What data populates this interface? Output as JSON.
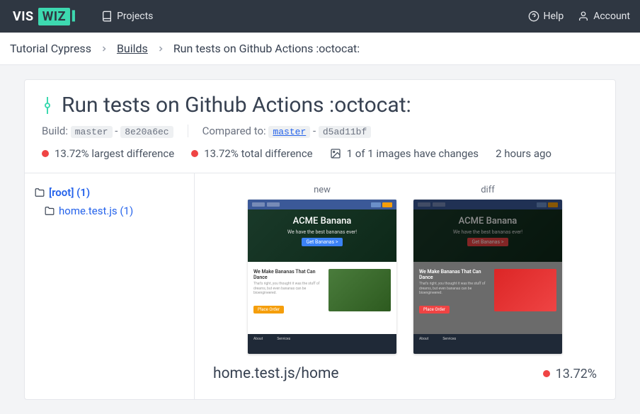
{
  "topbar": {
    "projects": "Projects",
    "help": "Help",
    "account": "Account"
  },
  "breadcrumb": {
    "item1": "Tutorial Cypress",
    "item2": "Builds",
    "item3": "Run tests on Github Actions :octocat:"
  },
  "header": {
    "title": "Run tests on Github Actions :octocat:",
    "build_label": "Build:",
    "build_branch": "master",
    "build_sha": "8e20a6ec",
    "compared_label": "Compared to:",
    "compared_branch": "master",
    "compared_sha": "d5ad11bf",
    "dash": "-"
  },
  "stats": {
    "largest": "13.72% largest difference",
    "total": "13.72% total difference",
    "images": "1 of 1 images have changes",
    "time": "2 hours ago"
  },
  "tree": {
    "root": "[root] (1)",
    "file": "home.test.js (1)"
  },
  "compare": {
    "new_label": "new",
    "diff_label": "diff",
    "result_name": "home.test.js/home",
    "result_pct": "13.72%"
  },
  "thumbs": {
    "hero_title": "ACME Banana",
    "hero_sub": "We have the best bananas ever!",
    "hero_btn_new": "Get Bananas >",
    "hero_btn_diff": "Get Bananas >",
    "body_title": "We Make Bananas That Can Dance",
    "body_sub": "That's right, you thought it was the stuff of dreams, but even bananas can be bioengineered.",
    "body_btn": "Place Order",
    "footer1": "About",
    "footer2": "Services"
  }
}
